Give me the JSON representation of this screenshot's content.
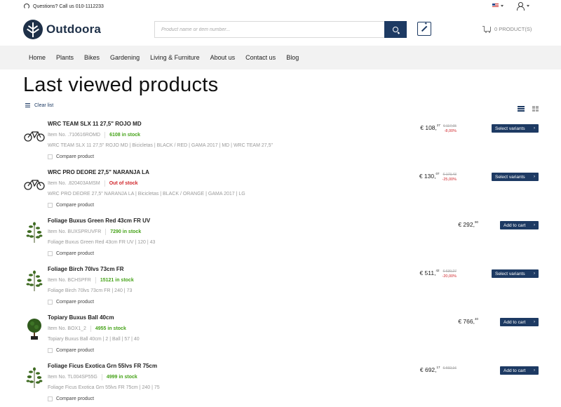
{
  "topbar": {
    "help_text": "Questions? Call us 010-1112233",
    "language_flag": "us-flag-icon"
  },
  "header": {
    "brand": "Outdoora",
    "search_placeholder": "Product name or item number...",
    "cart_label": "0 PRODUCT(S)"
  },
  "nav": {
    "items": [
      "Home",
      "Plants",
      "Bikes",
      "Gardening",
      "Living & Furniture",
      "About us",
      "Contact us",
      "Blog"
    ]
  },
  "page": {
    "title": "Last viewed products",
    "clear_label": "Clear list",
    "compare_label": "Compare product",
    "item_no_prefix": "Item No."
  },
  "colors": {
    "primary": "#1d3a63",
    "in_stock": "#46a319",
    "out_of_stock": "#d0262b"
  },
  "products": [
    {
      "name": "WRC TEAM SLX 11 27,5\" ROJO MD",
      "item_no": ".710616ROMD",
      "stock": "6108 in stock",
      "stock_status": "in",
      "description": "WRC TEAM SLX 11 27,5\" ROJO MD | Bicicletas | BLACK / RED | GAMA 2017 | MD | WRC TEAM 27,5\"",
      "price_main": "€ 108,",
      "price_cents": "27",
      "old_price": "€ 117,65",
      "discount": "-8,00%",
      "button": "Select variants",
      "thumb": "bike-icon"
    },
    {
      "name": "WRC PRO DEORE 27,5\" NARANJA LA",
      "item_no": ".820403AMSM",
      "stock": "Out of stock",
      "stock_status": "out",
      "description": "WRC PRO DEORE 27,5\" NARANJA LA | Bicicletas | BLACK / ORANGE | GAMA 2017 | LG",
      "price_main": "€ 130,",
      "price_cents": "07",
      "old_price": "€ 173,43",
      "discount": "-25,00%",
      "button": "Select variants",
      "thumb": "bike-icon"
    },
    {
      "name": "Foliage Buxus Green Red 43cm FR UV",
      "item_no": "BUXSPRUVFR",
      "stock": "7290 in stock",
      "stock_status": "in",
      "description": "Foliage Buxus Green Red 43cm FR UV | 120 | 43",
      "price_main": "€ 292,",
      "price_cents": "90",
      "old_price": "",
      "discount": "",
      "button": "Add to cart",
      "thumb": "plant-icon"
    },
    {
      "name": "Foliage Birch 70lvs 73cm FR",
      "item_no": "BCHSPFR",
      "stock": "15121 in stock",
      "stock_status": "in",
      "description": "Foliage Birch 70lvs 73cm FR | 240 | 73",
      "price_main": "€ 511,",
      "price_cents": "42",
      "old_price": "€ 639,27",
      "discount": "-20,00%",
      "button": "Select variants",
      "thumb": "plant-icon"
    },
    {
      "name": "Topiary Buxus Ball 40cm",
      "item_no": "BOX1_2",
      "stock": "4955 in stock",
      "stock_status": "in",
      "description": "Topiary Buxus Ball 40cm | 2 | Ball | 57 | 40",
      "price_main": "€ 766,",
      "price_cents": "40",
      "old_price": "",
      "discount": "",
      "button": "Add to cart",
      "thumb": "topiary-icon"
    },
    {
      "name": "Foliage Ficus Exotica Grn 55lvs FR 75cm",
      "item_no": "TL004SP55G",
      "stock": "4999 in stock",
      "stock_status": "in",
      "description": "Foliage Ficus Exotica Grn 55lvs FR 75cm | 240 | 75",
      "price_main": "€ 692,",
      "price_cents": "17",
      "old_price": "€ 692,16",
      "discount": "",
      "button": "Add to cart",
      "thumb": "plant-icon"
    }
  ]
}
